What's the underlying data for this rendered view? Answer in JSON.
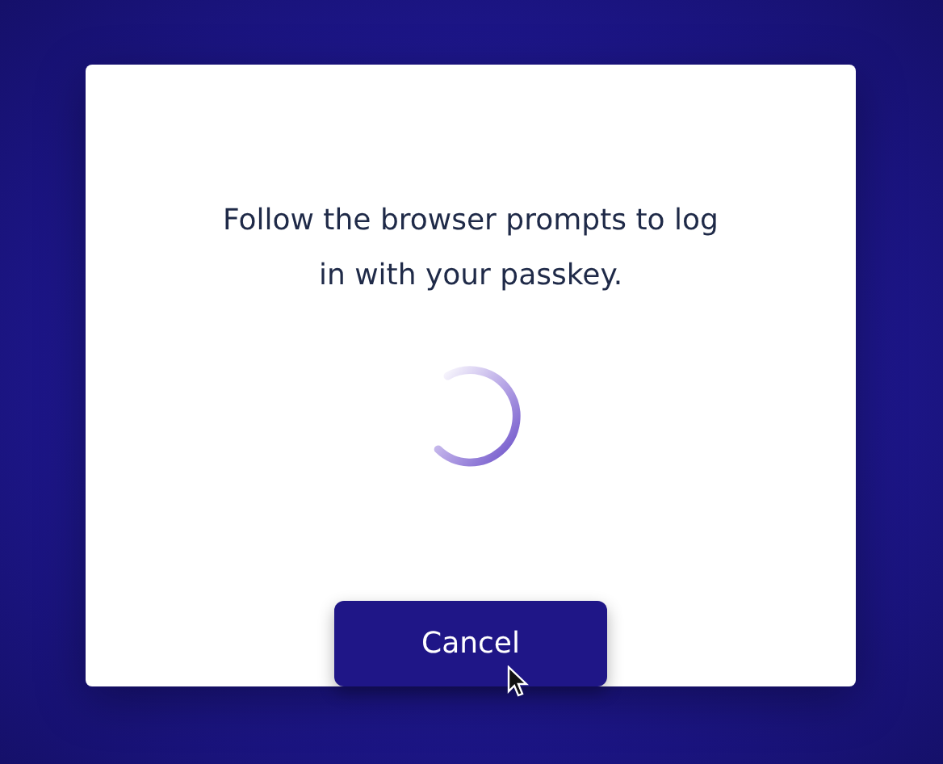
{
  "dialog": {
    "message": "Follow the browser prompts to log in with your passkey.",
    "button": "Cancel"
  }
}
